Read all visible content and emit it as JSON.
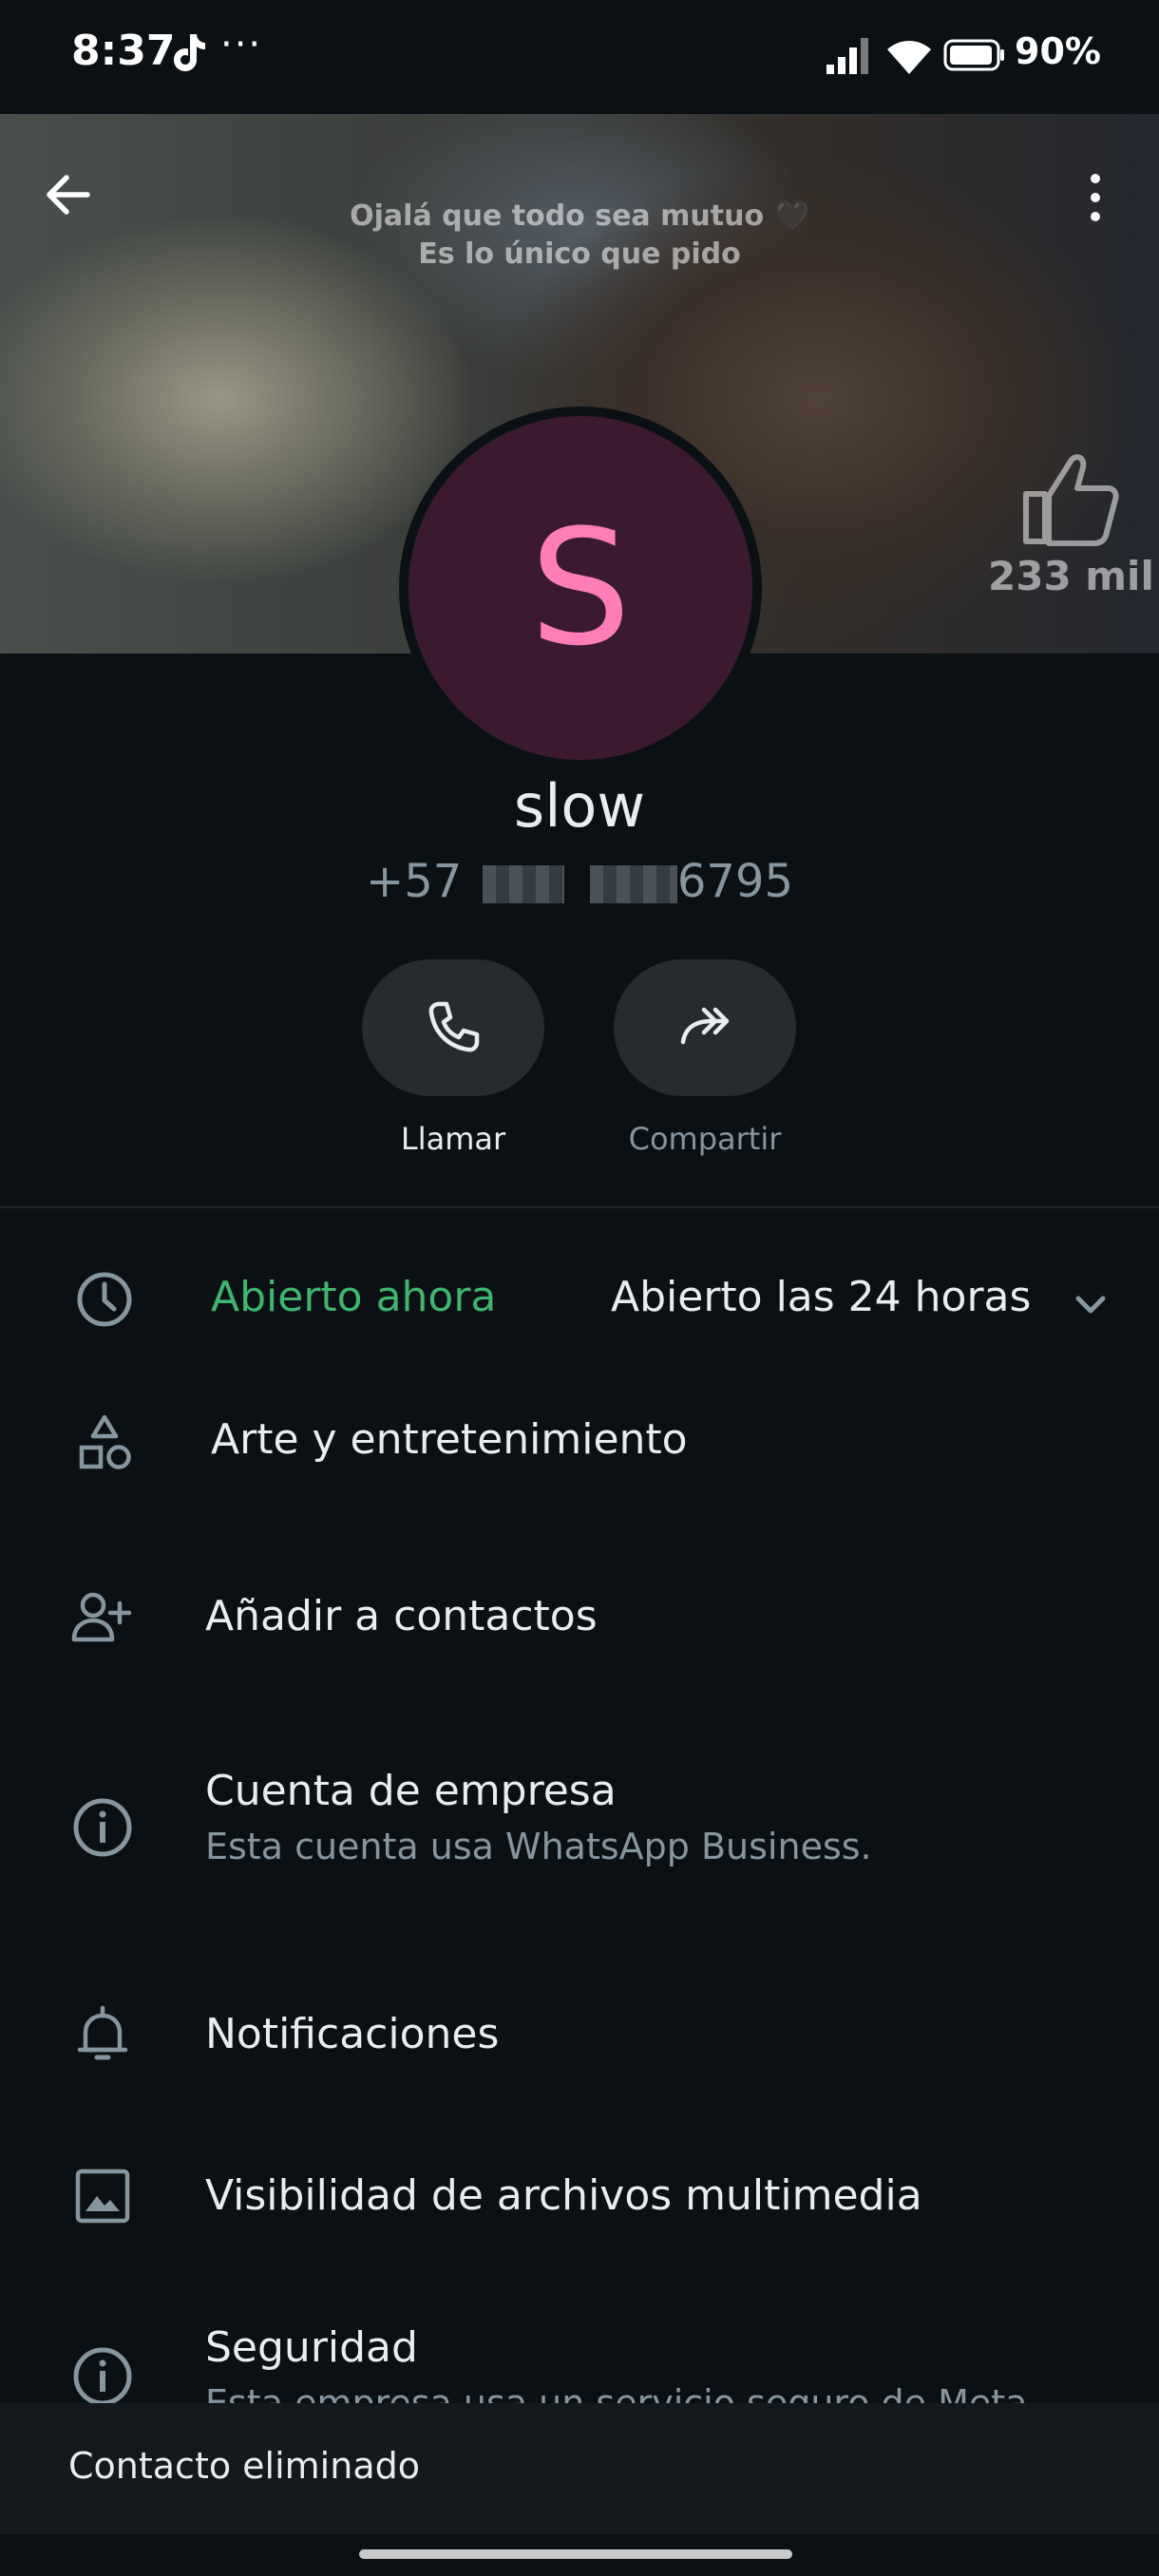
{
  "status_bar": {
    "time": "8:37",
    "more_dots": "···",
    "battery_percent": "90%",
    "icons": [
      "tiktok-icon",
      "signal-icon",
      "wifi-icon",
      "battery-icon"
    ]
  },
  "cover": {
    "caption_line1": "Ojalá que todo sea mutuo 🖤",
    "caption_line2": "Es lo único que pido",
    "likes": "233 mil"
  },
  "contact": {
    "avatar_letter": "S",
    "name": "slow",
    "phone_prefix": "+57",
    "phone_suffix": "6795"
  },
  "actions": {
    "call_label": "Llamar",
    "share_label": "Compartir"
  },
  "hours": {
    "status": "Abierto ahora",
    "schedule": "Abierto las 24 horas"
  },
  "category": "Arte y entretenimiento",
  "add_contact": "Añadir a contactos",
  "business_account": {
    "title": "Cuenta de empresa",
    "subtitle": "Esta cuenta usa WhatsApp Business."
  },
  "notifications": "Notificaciones",
  "media_visibility": "Visibilidad de archivos multimedia",
  "security": {
    "title": "Seguridad",
    "subtitle": "Esta empresa usa un servicio seguro de Meta"
  },
  "snackbar": "Contacto eliminado",
  "colors": {
    "background": "#0b1014",
    "accent_green": "#3fb56e",
    "avatar_bg": "#3b1a31",
    "avatar_letter": "#ff7eb6",
    "secondary_text": "#8696a0"
  }
}
